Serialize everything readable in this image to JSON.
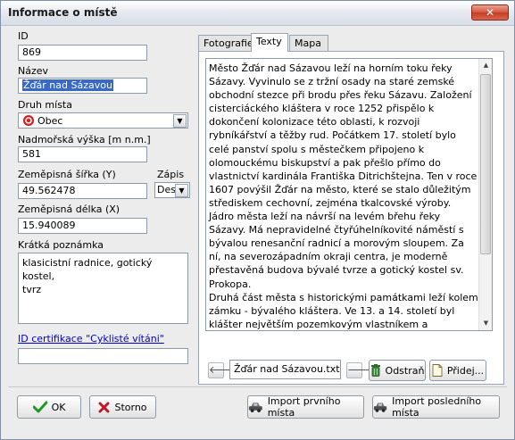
{
  "window": {
    "title": "Informace o místě",
    "close_glyph": "✕"
  },
  "form": {
    "id_label": "ID",
    "id_value": "869",
    "name_label": "Název",
    "name_value": "Žďár nad Sázavou",
    "type_label": "Druh místa",
    "type_value": "Obec",
    "altitude_label": "Nadmořská výška [m n.m.]",
    "altitude_value": "581",
    "lat_label": "Zeměpisná šířka (Y)",
    "lat_value": "49.562478",
    "format_label": "Zápis",
    "format_value": "Des",
    "lon_label": "Zeměpisná délka (X)",
    "lon_value": "15.940089",
    "note_label": "Krátká poznámka",
    "note_value": "klasicistní radnice, gotický kostel,\ntvrz",
    "cert_link": "ID certifikace \"Cyklisté vítáni\"",
    "cert_value": ""
  },
  "tabs": [
    {
      "label": "Fotografie",
      "active": false
    },
    {
      "label": "Texty",
      "active": true
    },
    {
      "label": "Mapa",
      "active": false
    }
  ],
  "texts": {
    "content": "Město Žďár nad Sázavou leží na horním toku řeky Sázavy. Vyvinulo se z tržní osady na staré zemské obchodní stezce při brodu přes řeku Sázavu. Založení cisterciáckého kláštera v roce 1252 přispělo k dokončení kolonizace této oblasti, k rozvoji rybníkářství a těžby rud. Počátkem 17. století bylo celé panství spolu s městečkem připojeno k olomouckému biskupství a pak přešlo přímo do vlastnictví kardinála Františka Ditrichštejna. Ten v roce 1607 povýšil Žďár na město, které se stalo důležitým střediskem cechovní, zejména tkalcovské výroby. Jádro města leží na návrší na levém břehu řeky Sázavy. Má nepravidelné čtyřúhelníkovité náměstí s bývalou renesanční radnicí a morovým sloupem. Za ní, na severozápadním okraji centra, je moderně přestavěná budova bývalé tvrze a gotický kostel sv. Prokopa.\nDruhá část města s historickými památkami leží kolem zámku - bývalého kláštera. Ve 13. a 14. století byl klášter největším pozemkovým vlastníkem a rozhodující moc na českomoravském pomezí. Za husitských bouří byl asi v roce 1423 vypálen.\nNejvýznamnějšího rozkvětu dosáhl v první polovině 18. století, kdy byl významným kulturním centrem. Zejména za",
    "file_name": "Žďár nad Sázavou.txt",
    "prev_glyph": "🡐",
    "next_glyph": "🡒",
    "delete_label": "Odstraň",
    "add_label": "Přidej..."
  },
  "buttons": {
    "ok_label": "OK",
    "cancel_label": "Storno",
    "import_first_label": "Import prvního místa",
    "import_last_label": "Import posledního místa"
  },
  "icons": {
    "type_icon": "target-icon",
    "ok_icon": "checkmark-icon",
    "cancel_icon": "x-icon",
    "delete_icon": "trash-icon",
    "add_icon": "document-icon",
    "import_icon": "car-icon"
  },
  "colors": {
    "accent_selection": "#3669c8",
    "link": "#0000cc",
    "ok_green": "#1d9a23",
    "cancel_red": "#c4162a"
  }
}
